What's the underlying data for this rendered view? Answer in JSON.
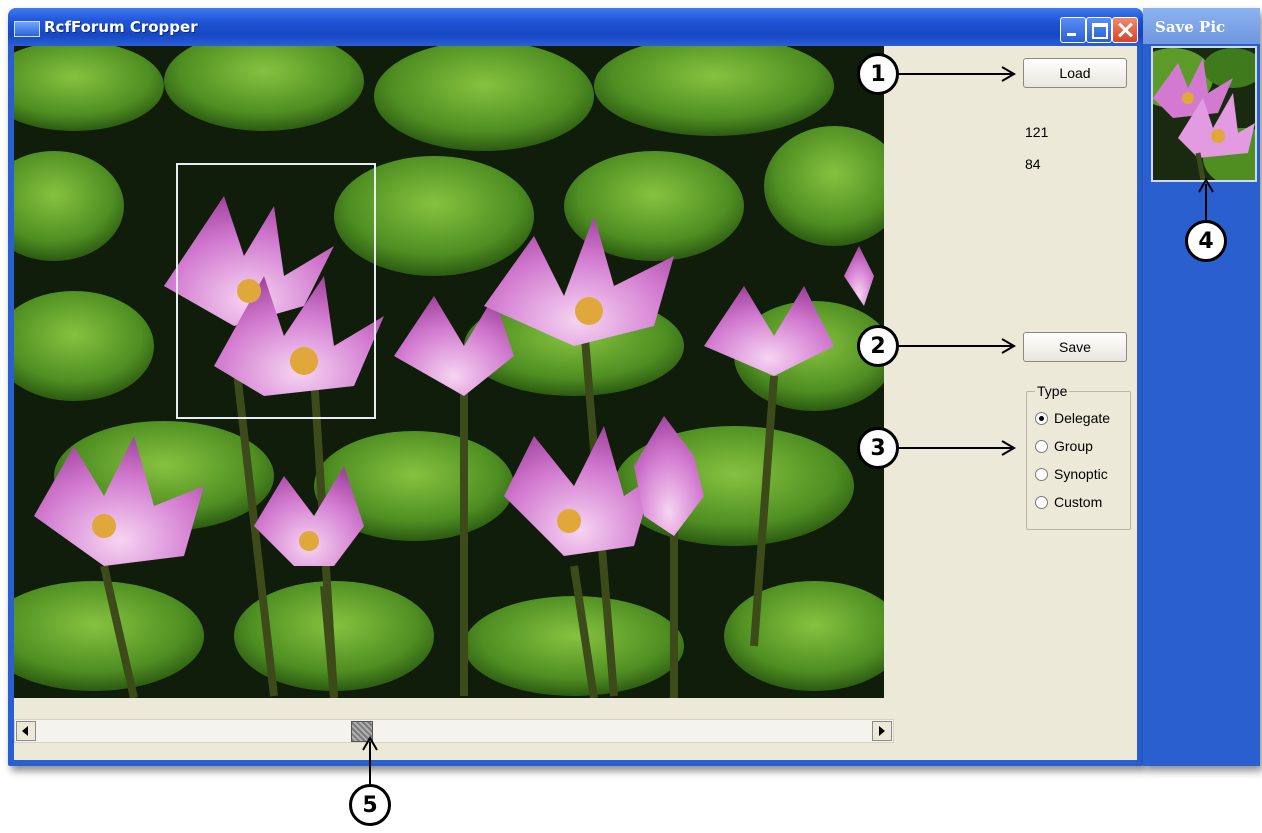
{
  "window": {
    "title": "RcfForum Cropper",
    "title_bar_color": "#1f54d6"
  },
  "controls": {
    "load_label": "Load",
    "save_label": "Save",
    "coord_x": "121",
    "coord_y": "84",
    "type_group": {
      "label": "Type",
      "options": [
        {
          "label": "Delegate",
          "selected": true
        },
        {
          "label": "Group",
          "selected": false
        },
        {
          "label": "Synoptic",
          "selected": false
        },
        {
          "label": "Custom",
          "selected": false
        }
      ]
    }
  },
  "scrollbar": {
    "position": 0.4
  },
  "save_pic": {
    "title": "Save Pic"
  },
  "callouts": [
    "1",
    "2",
    "3",
    "4",
    "5"
  ],
  "icons": {
    "app": "app-window-icon",
    "minimize": "minimize-icon",
    "maximize": "maximize-icon",
    "close": "close-icon",
    "scroll_left": "arrow-left-icon",
    "scroll_right": "arrow-right-icon"
  }
}
